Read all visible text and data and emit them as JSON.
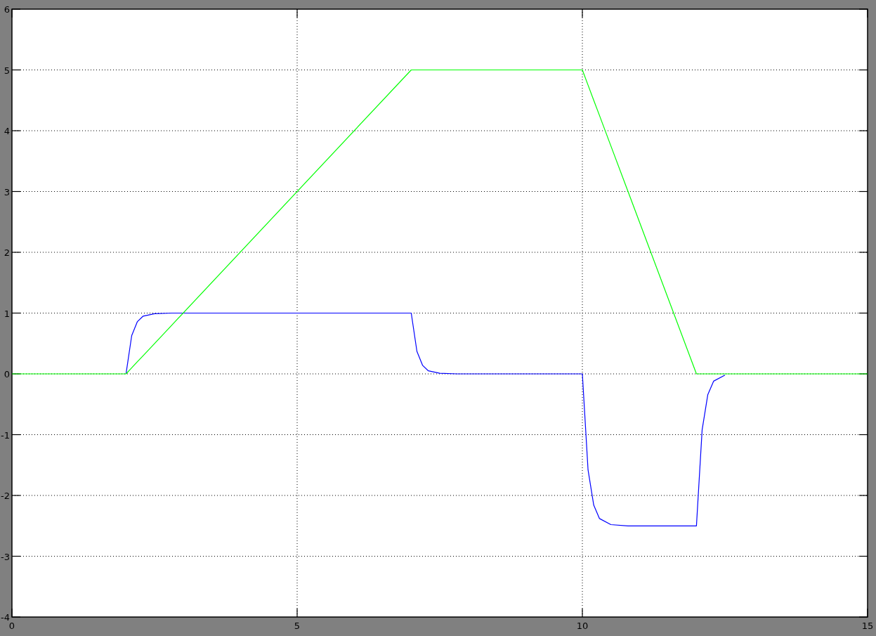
{
  "scope": {
    "chart_data": {
      "type": "line",
      "grid": true,
      "x": [
        0,
        2,
        2.1,
        2.2,
        2.3,
        2.5,
        2.8,
        7,
        7.1,
        7.2,
        7.3,
        7.5,
        7.8,
        10,
        10.1,
        10.2,
        10.3,
        10.5,
        10.8,
        12,
        12.1,
        12.2,
        12.3,
        12.5,
        12.8,
        15
      ],
      "series": [
        {
          "color": "#0000ff",
          "values": [
            null,
            0,
            0.63,
            0.86,
            0.95,
            0.99,
            1,
            1,
            0.37,
            0.14,
            0.05,
            0.01,
            0,
            0,
            -1.58,
            -2.16,
            -2.38,
            -2.48,
            -2.5,
            -2.5,
            -0.92,
            -0.34,
            -0.12,
            -0.02,
            null,
            null
          ]
        },
        {
          "color": "#00ff00",
          "values": [
            0,
            0,
            0.1,
            0.2,
            0.3,
            0.5,
            0.8,
            5,
            5,
            5,
            5,
            5,
            5,
            5,
            4.75,
            4.5,
            4.25,
            3.75,
            3,
            0,
            0,
            0,
            0,
            0,
            0,
            0
          ]
        }
      ],
      "xlim": [
        0,
        15
      ],
      "ylim": [
        -4,
        6
      ],
      "xticks": [
        0,
        5,
        10,
        15
      ],
      "yticks": [
        -4,
        -3,
        -2,
        -1,
        0,
        1,
        2,
        3,
        4,
        5,
        6
      ]
    }
  }
}
